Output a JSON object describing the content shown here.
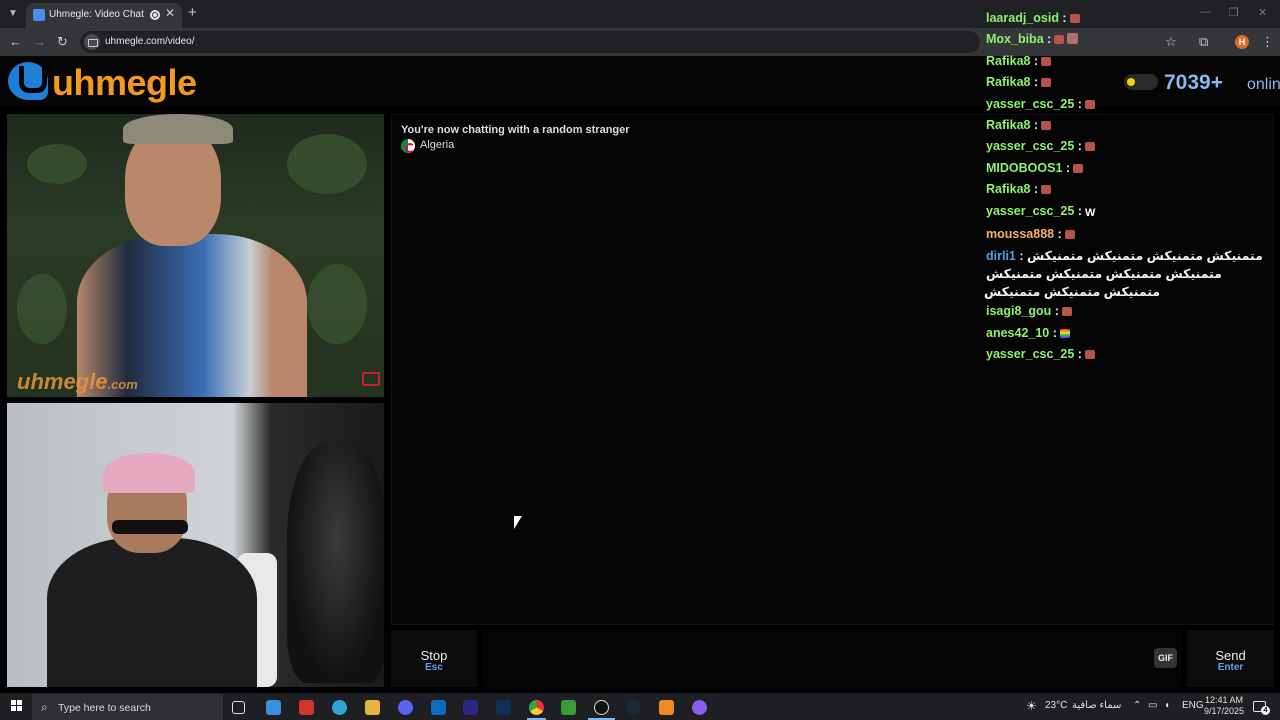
{
  "browser": {
    "tab_title": "Uhmegle: Video Chat | Ome",
    "url": "uhmegle.com/video/",
    "profile_initial": "H"
  },
  "site": {
    "logo_text": "uhmegle",
    "online_count": "7039+",
    "online_label": "online",
    "watermark": "uhmegle",
    "watermark_tld": ".com"
  },
  "chat": {
    "status": "You're now chatting with a random stranger",
    "country": "Algeria"
  },
  "controls": {
    "stop_label": "Stop",
    "stop_key": "Esc",
    "gif_label": "GIF",
    "send_label": "Send",
    "send_key": "Enter"
  },
  "overlay_chat": [
    {
      "name": "laaradj_osid",
      "color": "green"
    },
    {
      "name": "Mox_biba",
      "color": "green"
    },
    {
      "name": "Rafika8",
      "color": "green"
    },
    {
      "name": "Rafika8",
      "color": "green"
    },
    {
      "name": "yasser_csc_25",
      "color": "green"
    },
    {
      "name": "Rafika8",
      "color": "green"
    },
    {
      "name": "yasser_csc_25",
      "color": "green"
    },
    {
      "name": "MIDOBOOS1",
      "color": "green"
    },
    {
      "name": "Rafika8",
      "color": "green"
    },
    {
      "name": "yasser_csc_25",
      "color": "green",
      "glyph": "W"
    },
    {
      "name": "moussa888",
      "color": "orange"
    },
    {
      "name": "dirli1",
      "color": "blue",
      "text": "متمنيكش متمنيكش متمنيكش متمنيكش متمنيكش متمنيكش متمنيكش متمنيكش متمنيكش متمنيكش متمنيكش"
    },
    {
      "name": "isagi8_gou",
      "color": "green"
    },
    {
      "name": "anes42_10",
      "color": "green",
      "emoji": "rainbow"
    },
    {
      "name": "yasser_csc_25",
      "color": "green"
    }
  ],
  "taskbar": {
    "search_placeholder": "Type here to search",
    "weather_temp": "23°C",
    "weather_desc": "سماء صافية",
    "language": "ENG",
    "time": "12:41 AM",
    "date": "9/17/2025",
    "notifications": "4"
  },
  "colors": {
    "brand_orange": "#f39a1d",
    "brand_blue": "#1f7ed6",
    "online_blue": "#8ab8ee",
    "chat_name_green": "#8ef26d",
    "key_hint_blue": "#5aa0ea"
  }
}
